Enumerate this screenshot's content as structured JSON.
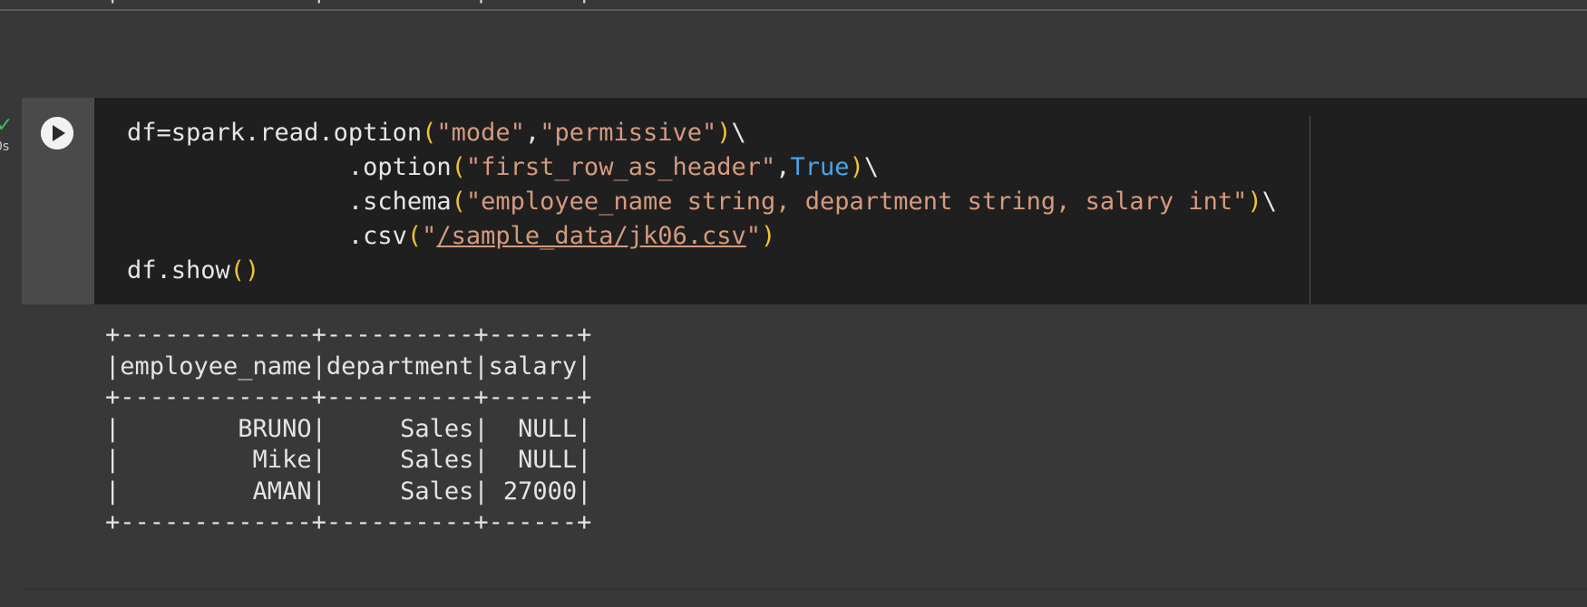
{
  "previous_output": {
    "table_border": "+-------------+----------+------+"
  },
  "cell": {
    "exec_status": {
      "check": "✓",
      "time": "0s"
    },
    "run_button_icon": "play-icon",
    "code": {
      "l1_a": "df=spark.read.option",
      "l1_p1": "(",
      "l1_s1": "\"mode\"",
      "l1_c": ",",
      "l1_s2": "\"permissive\"",
      "l1_p2": ")",
      "l1_bs": "\\",
      "l2_a": "               .option",
      "l2_p1": "(",
      "l2_s1": "\"first_row_as_header\"",
      "l2_c": ",",
      "l2_kw": "True",
      "l2_p2": ")",
      "l2_bs": "\\",
      "l3_a": "               .schema",
      "l3_p1": "(",
      "l3_s1": "\"employee_name string, department string, salary int\"",
      "l3_p2": ")",
      "l3_bs": "\\",
      "l4_a": "               .csv",
      "l4_p1": "(",
      "l4_q1": "\"",
      "l4_path": "/sample_data/jk06.csv",
      "l4_q2": "\"",
      "l4_p2": ")",
      "l5_a": "df.show",
      "l5_p": "()"
    },
    "output": {
      "border": "+-------------+----------+------+",
      "header": "|employee_name|department|salary|",
      "rows": [
        "|        BRUNO|     Sales|  NULL|",
        "|         Mike|     Sales|  NULL|",
        "|         AMAN|     Sales| 27000|"
      ]
    }
  },
  "colors": {
    "background": "#383838",
    "editor_bg": "#1f1f1f",
    "gutter_bg": "#4a4a4a",
    "string": "#d59a7d",
    "paren": "#f0c330",
    "keyword": "#4aa3e8",
    "check": "#3fbf55"
  }
}
